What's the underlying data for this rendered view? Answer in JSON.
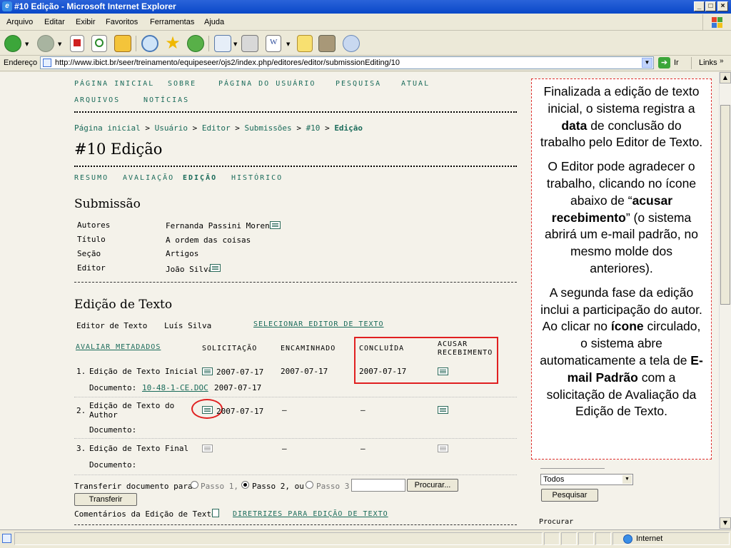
{
  "window": {
    "title": "#10 Edição - Microsoft Internet Explorer"
  },
  "menu": [
    "Arquivo",
    "Editar",
    "Exibir",
    "Favoritos",
    "Ferramentas",
    "Ajuda"
  ],
  "address": {
    "label": "Endereço",
    "url": "http://www.ibict.br/seer/treinamento/equipeseer/ojs2/index.php/editores/editor/submissionEditing/10",
    "go_label": "Ir",
    "links_label": "Links"
  },
  "nav": {
    "items": [
      "PÁGINA INICIAL",
      "SOBRE",
      "PÁGINA DO USUÁRIO",
      "PESQUISA",
      "ATUAL",
      "ARQUIVOS",
      "NOTÍCIAS"
    ]
  },
  "breadcrumb": {
    "items": [
      "Página inicial",
      "Usuário",
      "Editor",
      "Submissões",
      "#10"
    ],
    "current": "Edição",
    "sep": ">"
  },
  "page_title": "#10 Edição",
  "tabs": [
    "RESUMO",
    "AVALIAÇÃO",
    "EDIÇÃO",
    "HISTÓRICO"
  ],
  "submission": {
    "heading": "Submissão",
    "rows": [
      {
        "label": "Autores",
        "value": "Fernanda Passini Moreno"
      },
      {
        "label": "Título",
        "value": "A ordem das coisas"
      },
      {
        "label": "Seção",
        "value": "Artigos"
      },
      {
        "label": "Editor",
        "value": "João Silva"
      }
    ]
  },
  "copyedit": {
    "heading": "Edição de Texto",
    "editor_label": "Editor de Texto",
    "editor_name": "Luís Silva",
    "select_link": "SELECIONAR EDITOR DE TEXTO",
    "metadata_link": "AVALIAR METADADOS",
    "col_request": "SOLICITAÇÃO",
    "col_underway": "ENCAMINHADO",
    "col_complete": "CONCLUÍDA",
    "col_ack_1": "ACUSAR",
    "col_ack_2": "RECEBIMENTO",
    "steps": [
      {
        "num": "1.",
        "name": "Edição de Texto Inicial",
        "request": "2007-07-17",
        "underway": "2007-07-17",
        "complete": "2007-07-17",
        "doc_label": "Documento:",
        "doc_link": "10-48-1-CE.DOC",
        "doc_date": "2007-07-17"
      },
      {
        "num": "2.",
        "name_1": "Edição de Texto do",
        "name_2": "Author",
        "request": "2007-07-17",
        "underway": "—",
        "complete": "—",
        "doc_label": "Documento:"
      },
      {
        "num": "3.",
        "name": "Edição de Texto Final",
        "underway": "—",
        "complete": "—",
        "doc_label": "Documento:"
      }
    ],
    "transfer_label": "Transferir documento para",
    "step1": "Passo 1,",
    "step2": "Passo 2, ou",
    "step3": "Passo 3",
    "browse_button": "Procurar...",
    "transfer_button": "Transferir",
    "comments_label": "Comentários da Edição de Texto",
    "guidelines_link": "DIRETRIZES PARA EDIÇÃO DE TEXTO"
  },
  "sidebar": {
    "select_value": "Todos",
    "search_button": "Pesquisar",
    "browse_label": "Procurar"
  },
  "callout": {
    "p1_a": "Finalizada a edição de texto inicial, o sistema registra a ",
    "p1_b": "data",
    "p1_c": " de conclusão do trabalho pelo Editor de Texto.",
    "p2_a": "O Editor pode agradecer o trabalho, clicando no ícone abaixo de “",
    "p2_b": "acusar recebimento",
    "p2_c": "” (o sistema abrirá um e-mail padrão, no mesmo molde dos anteriores).",
    "p3_a": "A segunda fase da edição inclui a participação do autor. Ao clicar no ",
    "p3_b": "ícone",
    "p3_c": " circulado, o sistema abre automaticamente a  tela de ",
    "p3_d": "E-mail Padrão",
    "p3_e": " com a solicitação de Avaliação da Edição de Texto."
  },
  "status": {
    "zone": "Internet"
  },
  "colors": {
    "link": "#1a6b5a",
    "highlight": "#e02020",
    "titlebar": "#0a48c8"
  }
}
